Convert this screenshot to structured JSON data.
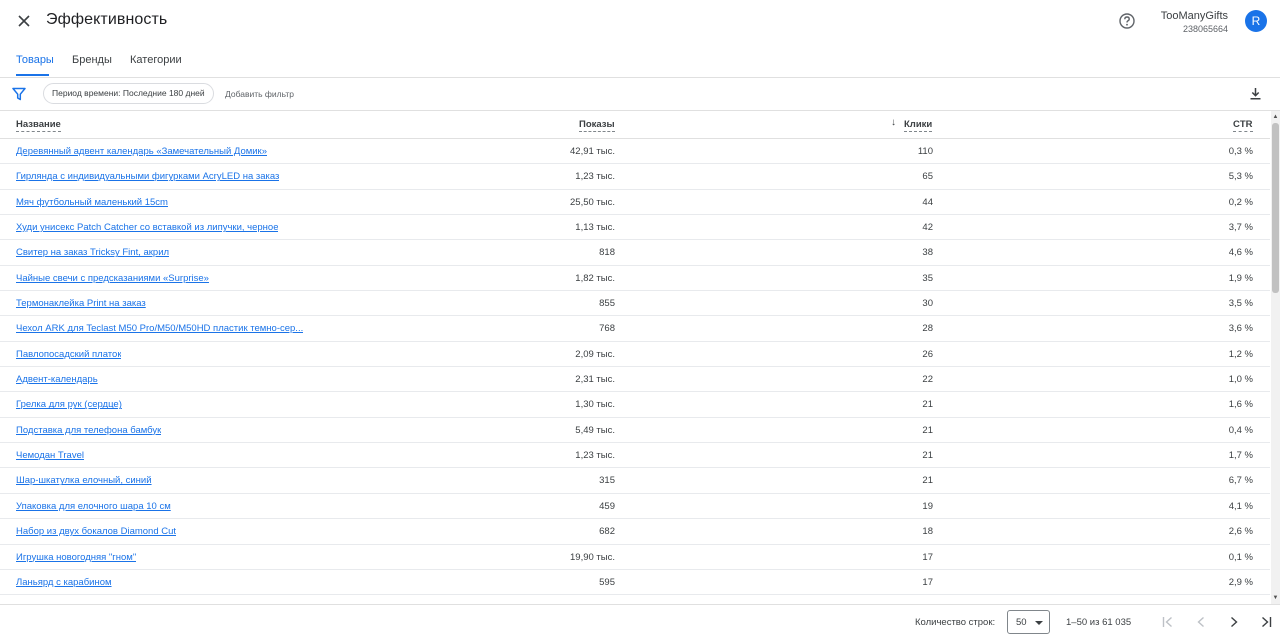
{
  "header": {
    "title": "Эффективность",
    "account_name": "TooManyGifts",
    "account_id": "238065664",
    "avatar_letter": "R"
  },
  "tabs": [
    {
      "label": "Товары",
      "active": true
    },
    {
      "label": "Бренды",
      "active": false
    },
    {
      "label": "Категории",
      "active": false
    }
  ],
  "filters": {
    "chip_label": "Период времени: Последние 180 дней",
    "add_filter_label": "Добавить фильтр"
  },
  "table": {
    "columns": [
      "Название",
      "Показы",
      "Клики",
      "CTR"
    ],
    "sorted_column": "Клики",
    "sort_direction": "desc",
    "rows": [
      {
        "name": "Деревянный адвент календарь «Замечательный Домик»",
        "impressions": "42,91 тыс.",
        "clicks": "110",
        "ctr": "0,3 %"
      },
      {
        "name": "Гирлянда с индивидуальными фигурками AcryLED на заказ",
        "impressions": "1,23 тыс.",
        "clicks": "65",
        "ctr": "5,3 %"
      },
      {
        "name": "Мяч футбольный маленький 15cm",
        "impressions": "25,50 тыс.",
        "clicks": "44",
        "ctr": "0,2 %"
      },
      {
        "name": "Худи унисекс Patch Catcher со вставкой из липучки, черное",
        "impressions": "1,13 тыс.",
        "clicks": "42",
        "ctr": "3,7 %"
      },
      {
        "name": "Свитер на заказ Tricksy Fint, акрил",
        "impressions": "818",
        "clicks": "38",
        "ctr": "4,6 %"
      },
      {
        "name": "Чайные свечи с предсказаниями «Surprise»",
        "impressions": "1,82 тыс.",
        "clicks": "35",
        "ctr": "1,9 %"
      },
      {
        "name": "Термонаклейка Print на заказ",
        "impressions": "855",
        "clicks": "30",
        "ctr": "3,5 %"
      },
      {
        "name": "Чехол ARK для Teclast M50 Pro/M50/M50HD пластик темно-сер...",
        "impressions": "768",
        "clicks": "28",
        "ctr": "3,6 %"
      },
      {
        "name": "Павлопосадский платок",
        "impressions": "2,09 тыс.",
        "clicks": "26",
        "ctr": "1,2 %"
      },
      {
        "name": "Адвент-календарь",
        "impressions": "2,31 тыс.",
        "clicks": "22",
        "ctr": "1,0 %"
      },
      {
        "name": "Грелка для рук (сердце)",
        "impressions": "1,30 тыс.",
        "clicks": "21",
        "ctr": "1,6 %"
      },
      {
        "name": "Подставка для телефона бамбук",
        "impressions": "5,49 тыс.",
        "clicks": "21",
        "ctr": "0,4 %"
      },
      {
        "name": "Чемодан Travel",
        "impressions": "1,23 тыс.",
        "clicks": "21",
        "ctr": "1,7 %"
      },
      {
        "name": "Шар-шкатулка елочный, синий",
        "impressions": "315",
        "clicks": "21",
        "ctr": "6,7 %"
      },
      {
        "name": "Упаковка для елочного шара 10 см",
        "impressions": "459",
        "clicks": "19",
        "ctr": "4,1 %"
      },
      {
        "name": "Набор из двух бокалов Diamond Cut",
        "impressions": "682",
        "clicks": "18",
        "ctr": "2,6 %"
      },
      {
        "name": "Игрушка новогодняя \"гном\"",
        "impressions": "19,90 тыс.",
        "clicks": "17",
        "ctr": "0,1 %"
      },
      {
        "name": "Ланьярд с карабином",
        "impressions": "595",
        "clicks": "17",
        "ctr": "2,9 %"
      }
    ]
  },
  "footer": {
    "rows_per_page_label": "Количество строк:",
    "rows_per_page_value": "50",
    "range_text": "1–50 из 61 035"
  },
  "colors": {
    "accent": "#1a73e8",
    "text": "#3c4043",
    "divider": "#e0e0e0"
  },
  "icons": [
    "close-icon",
    "help-icon",
    "filter-icon",
    "download-icon",
    "first-page-icon",
    "prev-page-icon",
    "next-page-icon",
    "last-page-icon"
  ]
}
